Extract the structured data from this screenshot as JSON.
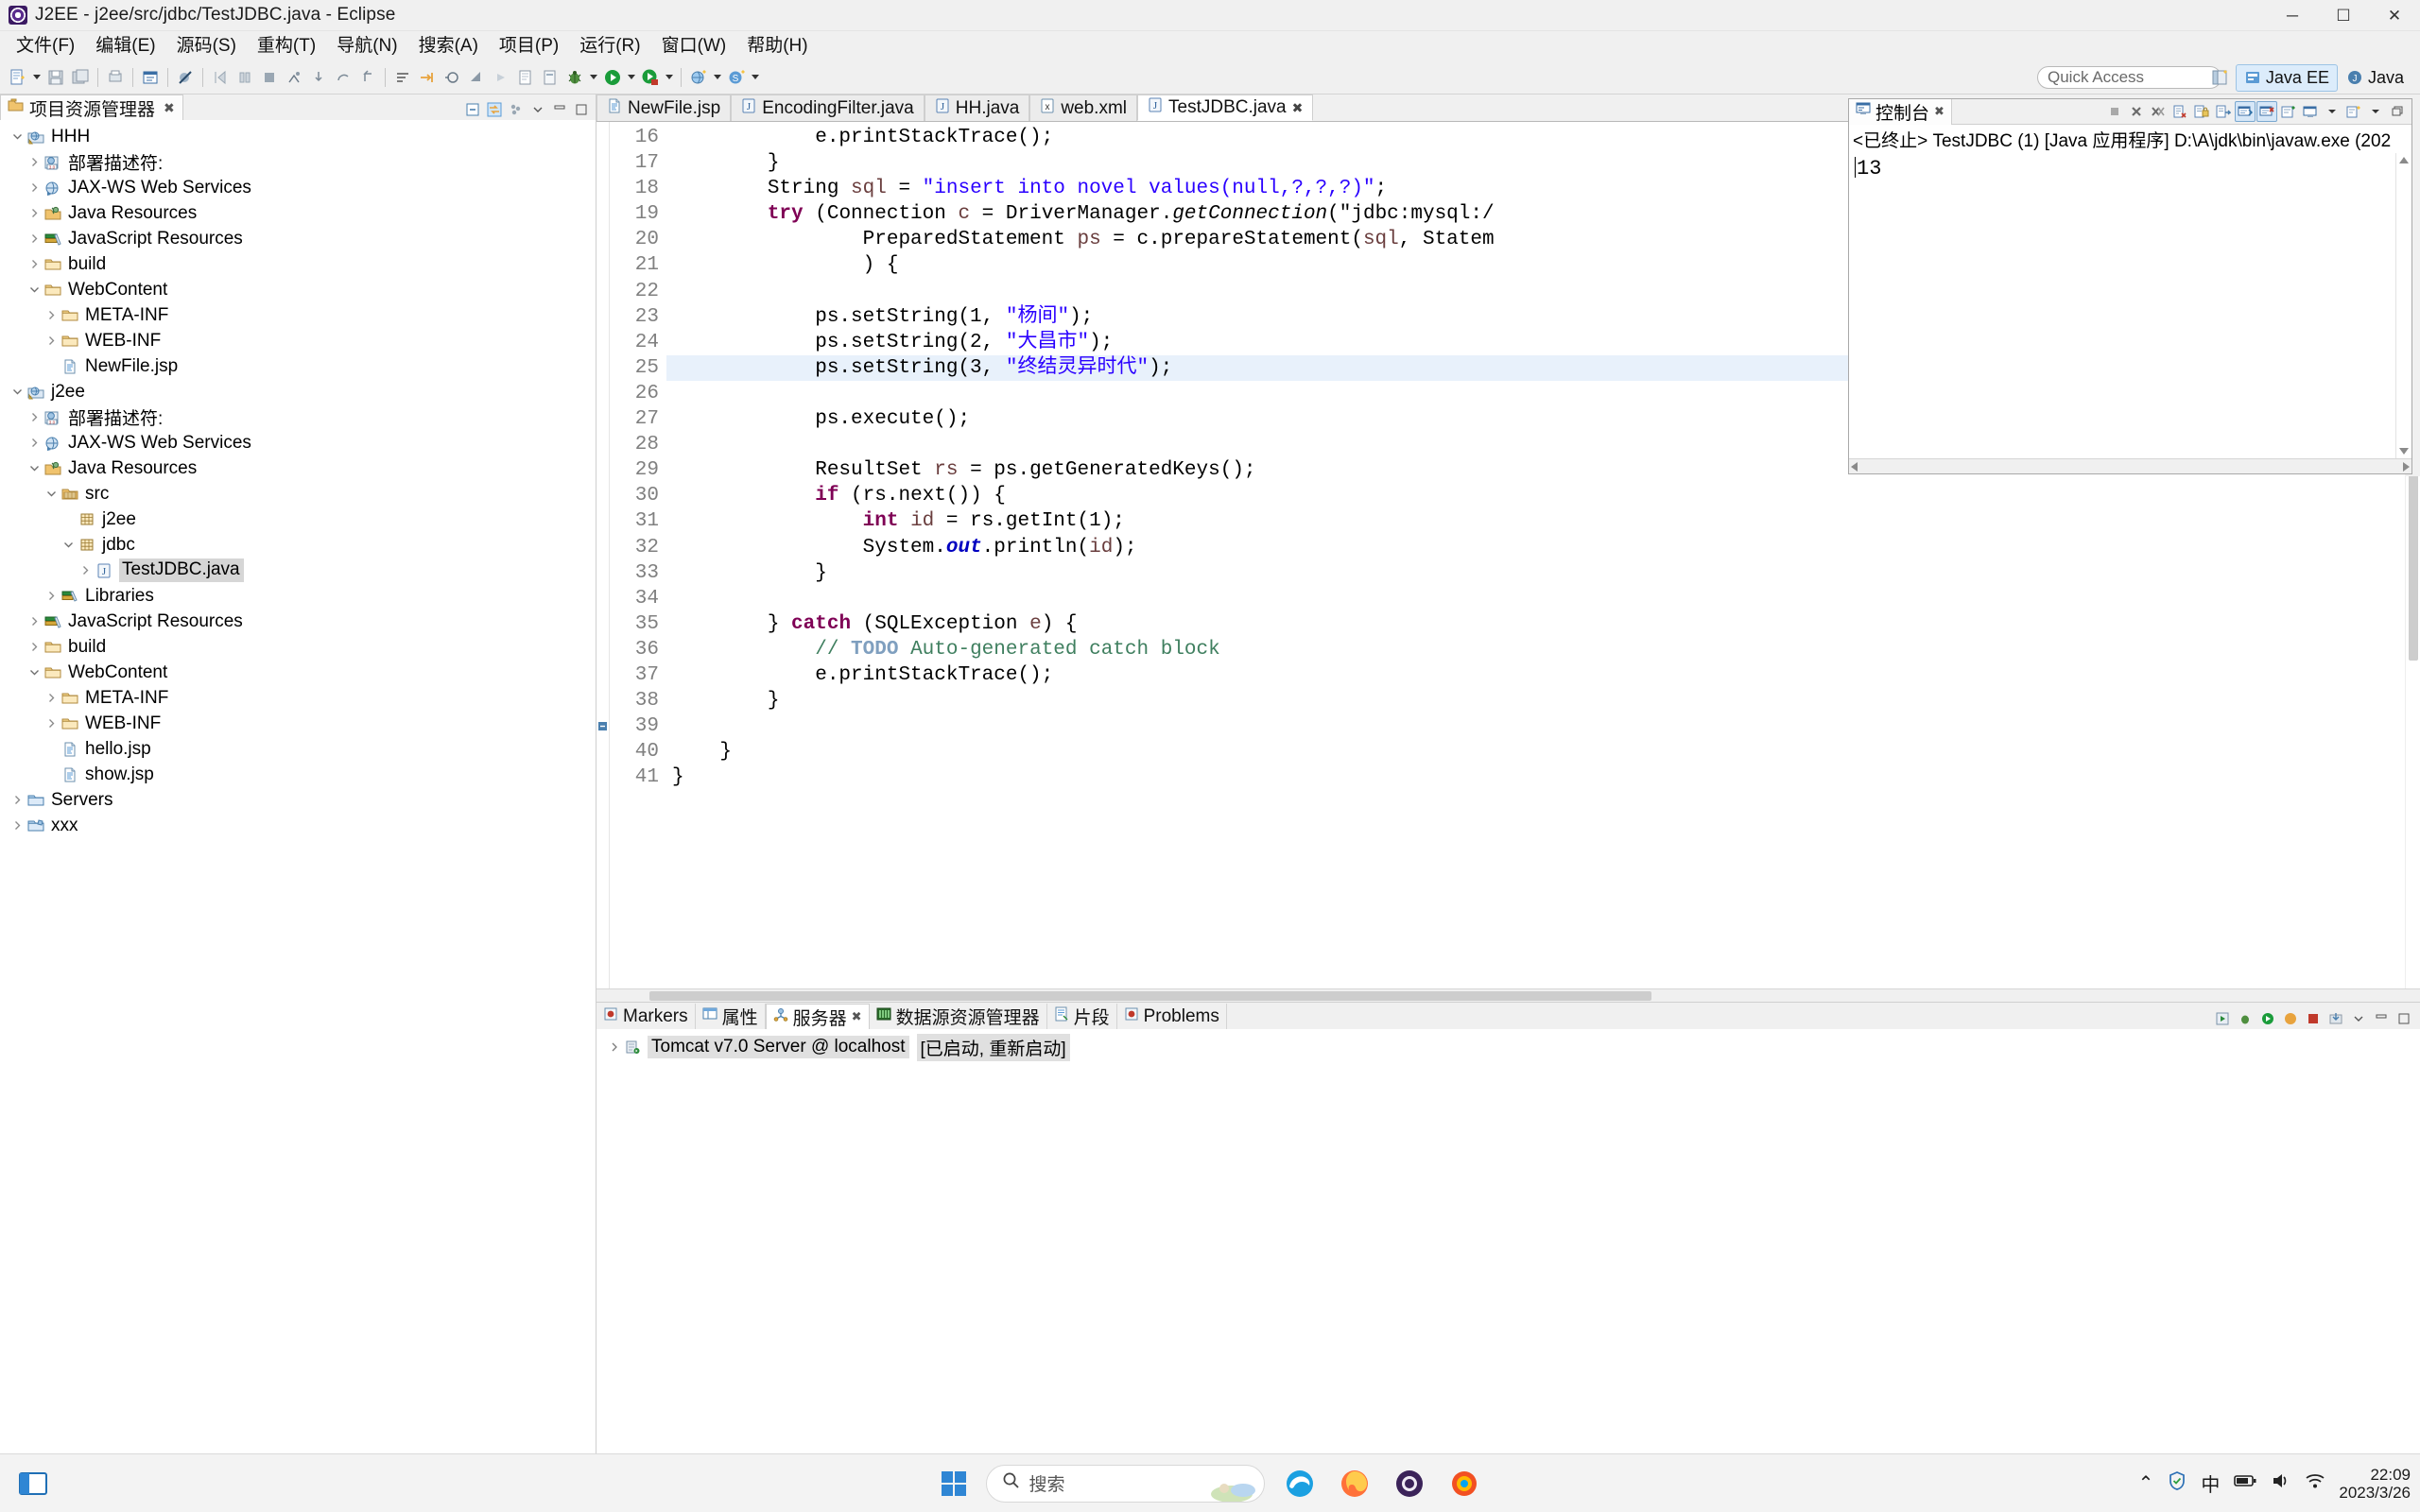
{
  "window": {
    "title": "J2EE - j2ee/src/jdbc/TestJDBC.java - Eclipse",
    "app_icon": "eclipse-icon",
    "minimize": "─",
    "maximize": "☐",
    "close": "✕"
  },
  "menubar": [
    {
      "label": "文件(F)",
      "name": "menu-file"
    },
    {
      "label": "编辑(E)",
      "name": "menu-edit"
    },
    {
      "label": "源码(S)",
      "name": "menu-source"
    },
    {
      "label": "重构(T)",
      "name": "menu-refactor"
    },
    {
      "label": "导航(N)",
      "name": "menu-navigate"
    },
    {
      "label": "搜索(A)",
      "name": "menu-search"
    },
    {
      "label": "项目(P)",
      "name": "menu-project"
    },
    {
      "label": "运行(R)",
      "name": "menu-run"
    },
    {
      "label": "窗口(W)",
      "name": "menu-window"
    },
    {
      "label": "帮助(H)",
      "name": "menu-help"
    }
  ],
  "toolbar": {
    "quick_access_placeholder": "Quick Access",
    "perspectives": [
      {
        "label": "Java EE",
        "active": true
      },
      {
        "label": "Java",
        "active": false
      }
    ]
  },
  "project_explorer": {
    "tab_label": "项目资源管理器",
    "tree": [
      {
        "label": "HHH",
        "depth": 0,
        "twisty": "open",
        "icon": "dynamic-web-project-icon",
        "selected": false
      },
      {
        "label": "部署描述符:",
        "depth": 1,
        "twisty": "closed",
        "icon": "deployment-descriptor-icon",
        "selected": false
      },
      {
        "label": "JAX-WS Web Services",
        "depth": 1,
        "twisty": "closed",
        "icon": "jaxws-icon",
        "selected": false
      },
      {
        "label": "Java Resources",
        "depth": 1,
        "twisty": "closed",
        "icon": "java-resources-icon",
        "selected": false
      },
      {
        "label": "JavaScript Resources",
        "depth": 1,
        "twisty": "closed",
        "icon": "javascript-resources-icon",
        "selected": false
      },
      {
        "label": "build",
        "depth": 1,
        "twisty": "closed",
        "icon": "folder-icon",
        "selected": false
      },
      {
        "label": "WebContent",
        "depth": 1,
        "twisty": "open",
        "icon": "folder-icon",
        "selected": false
      },
      {
        "label": "META-INF",
        "depth": 2,
        "twisty": "closed",
        "icon": "folder-icon",
        "selected": false
      },
      {
        "label": "WEB-INF",
        "depth": 2,
        "twisty": "closed",
        "icon": "folder-icon",
        "selected": false
      },
      {
        "label": "NewFile.jsp",
        "depth": 2,
        "twisty": "none",
        "icon": "jsp-file-icon",
        "selected": false
      },
      {
        "label": "j2ee",
        "depth": 0,
        "twisty": "open",
        "icon": "dynamic-web-project-icon",
        "selected": false
      },
      {
        "label": "部署描述符:",
        "depth": 1,
        "twisty": "closed",
        "icon": "deployment-descriptor-icon",
        "selected": false
      },
      {
        "label": "JAX-WS Web Services",
        "depth": 1,
        "twisty": "closed",
        "icon": "jaxws-icon",
        "selected": false
      },
      {
        "label": "Java Resources",
        "depth": 1,
        "twisty": "open",
        "icon": "java-resources-icon",
        "selected": false
      },
      {
        "label": "src",
        "depth": 2,
        "twisty": "open",
        "icon": "source-folder-icon",
        "selected": false
      },
      {
        "label": "j2ee",
        "depth": 3,
        "twisty": "none",
        "icon": "package-icon",
        "selected": false
      },
      {
        "label": "jdbc",
        "depth": 3,
        "twisty": "open",
        "icon": "package-icon",
        "selected": false
      },
      {
        "label": "TestJDBC.java",
        "depth": 4,
        "twisty": "closed",
        "icon": "java-file-icon",
        "selected": true
      },
      {
        "label": "Libraries",
        "depth": 2,
        "twisty": "closed",
        "icon": "libraries-icon",
        "selected": false
      },
      {
        "label": "JavaScript Resources",
        "depth": 1,
        "twisty": "closed",
        "icon": "javascript-resources-icon",
        "selected": false
      },
      {
        "label": "build",
        "depth": 1,
        "twisty": "closed",
        "icon": "folder-icon",
        "selected": false
      },
      {
        "label": "WebContent",
        "depth": 1,
        "twisty": "open",
        "icon": "folder-icon",
        "selected": false
      },
      {
        "label": "META-INF",
        "depth": 2,
        "twisty": "closed",
        "icon": "folder-icon",
        "selected": false
      },
      {
        "label": "WEB-INF",
        "depth": 2,
        "twisty": "closed",
        "icon": "folder-icon",
        "selected": false
      },
      {
        "label": "hello.jsp",
        "depth": 2,
        "twisty": "none",
        "icon": "jsp-file-icon",
        "selected": false
      },
      {
        "label": "show.jsp",
        "depth": 2,
        "twisty": "none",
        "icon": "jsp-file-icon",
        "selected": false
      },
      {
        "label": "Servers",
        "depth": 0,
        "twisty": "closed",
        "icon": "folder-blue-icon",
        "selected": false
      },
      {
        "label": "xxx",
        "depth": 0,
        "twisty": "closed",
        "icon": "project-icon",
        "selected": false
      }
    ]
  },
  "editor": {
    "tabs": [
      {
        "label": "NewFile.jsp",
        "icon": "jsp-file-icon",
        "active": false,
        "closable": false
      },
      {
        "label": "EncodingFilter.java",
        "icon": "java-file-icon",
        "active": false,
        "closable": false
      },
      {
        "label": "HH.java",
        "icon": "java-file-icon",
        "active": false,
        "closable": false
      },
      {
        "label": "web.xml",
        "icon": "xml-file-icon",
        "active": false,
        "closable": false
      },
      {
        "label": "TestJDBC.java",
        "icon": "java-file-icon",
        "active": true,
        "closable": true
      }
    ],
    "first_line_number": 16,
    "current_line": 25,
    "lines": [
      {
        "n": 16,
        "text": "            e.printStackTrace();"
      },
      {
        "n": 17,
        "text": "        }"
      },
      {
        "n": 18,
        "text": "        String sql = \"insert into novel values(null,?,?,?)\";"
      },
      {
        "n": 19,
        "text": "        try (Connection c = DriverManager.getConnection(\"jdbc:mysql:/"
      },
      {
        "n": 20,
        "text": "                PreparedStatement ps = c.prepareStatement(sql, Statem"
      },
      {
        "n": 21,
        "text": "                ) {"
      },
      {
        "n": 22,
        "text": ""
      },
      {
        "n": 23,
        "text": "            ps.setString(1, \"杨间\");"
      },
      {
        "n": 24,
        "text": "            ps.setString(2, \"大昌市\");"
      },
      {
        "n": 25,
        "text": "            ps.setString(3, \"终结灵异时代\");"
      },
      {
        "n": 26,
        "text": ""
      },
      {
        "n": 27,
        "text": "            ps.execute();"
      },
      {
        "n": 28,
        "text": ""
      },
      {
        "n": 29,
        "text": "            ResultSet rs = ps.getGeneratedKeys();"
      },
      {
        "n": 30,
        "text": "            if (rs.next()) {"
      },
      {
        "n": 31,
        "text": "                int id = rs.getInt(1);"
      },
      {
        "n": 32,
        "text": "                System.out.println(id);"
      },
      {
        "n": 33,
        "text": "            }"
      },
      {
        "n": 34,
        "text": ""
      },
      {
        "n": 35,
        "text": "        } catch (SQLException e) {"
      },
      {
        "n": 36,
        "text": "            // TODO Auto-generated catch block"
      },
      {
        "n": 37,
        "text": "            e.printStackTrace();"
      },
      {
        "n": 38,
        "text": "        }"
      },
      {
        "n": 39,
        "text": ""
      },
      {
        "n": 40,
        "text": "    }"
      },
      {
        "n": 41,
        "text": "}"
      }
    ]
  },
  "console": {
    "tab_label": "控制台",
    "header": "<已终止> TestJDBC  (1)   [Java 应用程序] D:\\A\\jdk\\bin\\javaw.exe  (202",
    "output": "13"
  },
  "bottom_panel": {
    "tabs": [
      {
        "label": "Markers",
        "icon": "markers-icon",
        "active": false
      },
      {
        "label": "属性",
        "icon": "properties-icon",
        "active": false
      },
      {
        "label": "服务器",
        "icon": "servers-icon",
        "active": true
      },
      {
        "label": "数据源资源管理器",
        "icon": "datasource-icon",
        "active": false
      },
      {
        "label": "片段",
        "icon": "snippets-icon",
        "active": false
      },
      {
        "label": "Problems",
        "icon": "problems-icon",
        "active": false
      }
    ],
    "server_row": {
      "name": "Tomcat v7.0 Server @ localhost",
      "state": "[已启动, 重新启动]",
      "icon": "tomcat-server-icon"
    }
  },
  "taskbar": {
    "start": "windows-start-icon",
    "search_placeholder": "搜索",
    "apps": [
      {
        "name": "edge-icon"
      },
      {
        "name": "firefox-icon"
      },
      {
        "name": "eclipse-icon"
      },
      {
        "name": "browser-icon"
      }
    ],
    "tray": {
      "chevron": "⌃",
      "security": "security-icon",
      "ime": "中",
      "battery": "battery-icon",
      "volume": "volume-icon",
      "network": "network-icon"
    },
    "clock_time": "22:09",
    "clock_date": "2023/3/26"
  },
  "colors": {
    "accent": "#2a00ff",
    "keyword": "#7f0055",
    "comment": "#3f7f5f",
    "todo": "#7f9fbf",
    "field": "#0000c0",
    "selection": "#e8f1fb"
  }
}
